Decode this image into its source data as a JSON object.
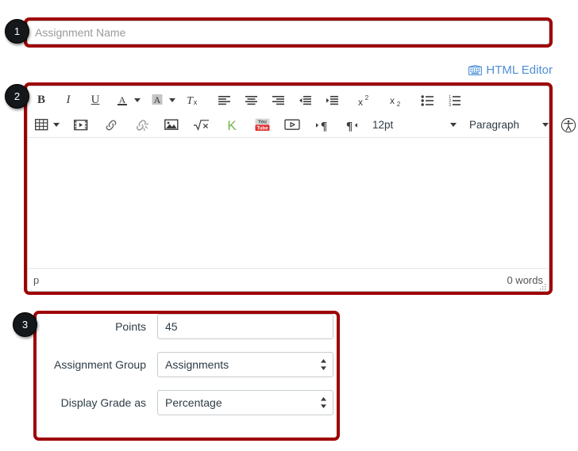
{
  "annotations": {
    "badges": [
      {
        "number": "1",
        "target": "assignment-name-field"
      },
      {
        "number": "2",
        "target": "rich-content-editor"
      },
      {
        "number": "3",
        "target": "assignment-details-form"
      }
    ],
    "outline_color": "#9e0000",
    "badge_color": "#15181b"
  },
  "assignment_name": {
    "placeholder": "Assignment Name",
    "value": ""
  },
  "html_editor": {
    "label": "HTML Editor",
    "icon": "keyboard-icon",
    "color": "#4e8fd4"
  },
  "editor": {
    "toolbar_row_1": [
      {
        "name": "bold-button",
        "label": "B",
        "icon": "bold-icon"
      },
      {
        "name": "italic-button",
        "label": "I",
        "icon": "italic-icon"
      },
      {
        "name": "underline-button",
        "label": "U",
        "icon": "underline-icon"
      },
      {
        "name": "text-color-button",
        "label": "A",
        "icon": "text-color-icon",
        "has_caret": true
      },
      {
        "name": "highlight-color-button",
        "label": "A",
        "icon": "highlight-color-icon",
        "has_caret": true
      },
      {
        "name": "clear-formatting-button",
        "label": "Tx",
        "icon": "clear-formatting-icon"
      },
      {
        "name": "align-left-button",
        "label": "",
        "icon": "align-left-icon"
      },
      {
        "name": "align-center-button",
        "label": "",
        "icon": "align-center-icon"
      },
      {
        "name": "align-right-button",
        "label": "",
        "icon": "align-right-icon"
      },
      {
        "name": "outdent-button",
        "label": "",
        "icon": "outdent-icon"
      },
      {
        "name": "indent-button",
        "label": "",
        "icon": "indent-icon"
      },
      {
        "name": "superscript-button",
        "label": "x2",
        "icon": "superscript-icon"
      },
      {
        "name": "subscript-button",
        "label": "x2",
        "icon": "subscript-icon"
      },
      {
        "name": "bulleted-list-button",
        "label": "",
        "icon": "bulleted-list-icon"
      },
      {
        "name": "numbered-list-button",
        "label": "",
        "icon": "numbered-list-icon"
      }
    ],
    "toolbar_row_2": [
      {
        "name": "table-button",
        "icon": "table-icon",
        "has_caret": true
      },
      {
        "name": "media-button",
        "icon": "film-icon"
      },
      {
        "name": "link-button",
        "icon": "link-icon"
      },
      {
        "name": "unlink-button",
        "icon": "unlink-icon"
      },
      {
        "name": "image-button",
        "icon": "image-icon"
      },
      {
        "name": "math-equation-button",
        "icon": "math-icon"
      },
      {
        "name": "kaltura-button",
        "icon": "kaltura-k-icon"
      },
      {
        "name": "youtube-button",
        "icon": "youtube-icon"
      },
      {
        "name": "record-video-button",
        "icon": "video-play-icon"
      },
      {
        "name": "ltr-button",
        "icon": "direction-ltr-icon"
      },
      {
        "name": "rtl-button",
        "icon": "direction-rtl-icon"
      }
    ],
    "font_size": {
      "label": "12pt",
      "name": "font-size-select"
    },
    "block_format": {
      "label": "Paragraph",
      "name": "paragraph-format-select"
    },
    "accessibility_checker": {
      "icon": "accessibility-icon",
      "name": "accessibility-checker-button"
    },
    "content": "",
    "status": {
      "path": "p",
      "word_count": "0 words"
    }
  },
  "details_form": {
    "rows": [
      {
        "label": "Points",
        "type": "text",
        "value": "45",
        "field_name": "points-input"
      },
      {
        "label": "Assignment Group",
        "type": "select",
        "value": "Assignments",
        "field_name": "assignment-group-select"
      },
      {
        "label": "Display Grade as",
        "type": "select",
        "value": "Percentage",
        "field_name": "display-grade-as-select"
      }
    ]
  }
}
